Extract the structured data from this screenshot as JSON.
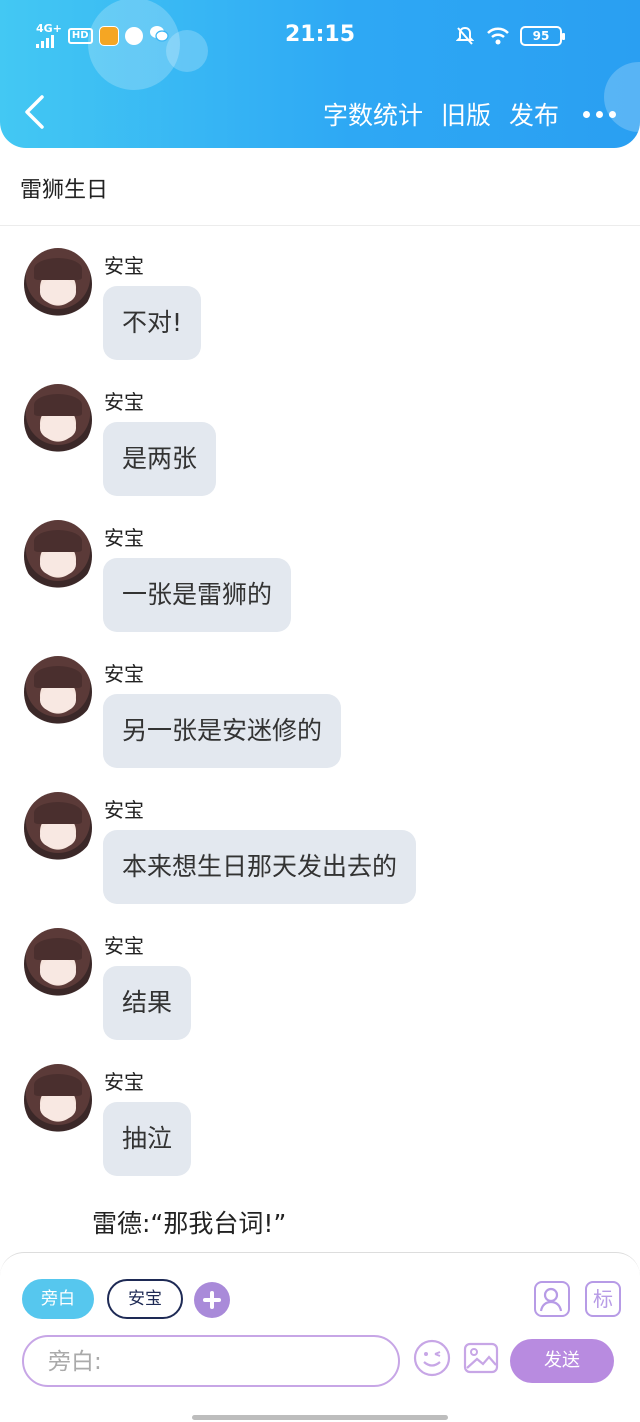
{
  "status_bar": {
    "network": "4G+",
    "hd": "HD",
    "time": "21:15",
    "battery": "95"
  },
  "nav": {
    "word_count": "字数统计",
    "old_version": "旧版",
    "publish": "发布"
  },
  "document": {
    "title": "雷狮生日"
  },
  "messages": [
    {
      "sender": "安宝",
      "text": "不对!"
    },
    {
      "sender": "安宝",
      "text": "是两张"
    },
    {
      "sender": "安宝",
      "text": "一张是雷狮的"
    },
    {
      "sender": "安宝",
      "text": "另一张是安迷修的"
    },
    {
      "sender": "安宝",
      "text": "本来想生日那天发出去的"
    },
    {
      "sender": "安宝",
      "text": "结果"
    },
    {
      "sender": "安宝",
      "text": "抽泣"
    }
  ],
  "narration": "雷德:“那我台词!”",
  "composer": {
    "chip_narration": "旁白",
    "chip_role": "安宝",
    "tag_icon": "标",
    "input_placeholder": "旁白:",
    "send": "发送"
  },
  "colors": {
    "header_start": "#43c8f3",
    "header_end": "#2a9ff2",
    "bubble": "#e3e8ef",
    "accent_purple": "#b88be0",
    "chip_blue": "#56c7ee"
  }
}
